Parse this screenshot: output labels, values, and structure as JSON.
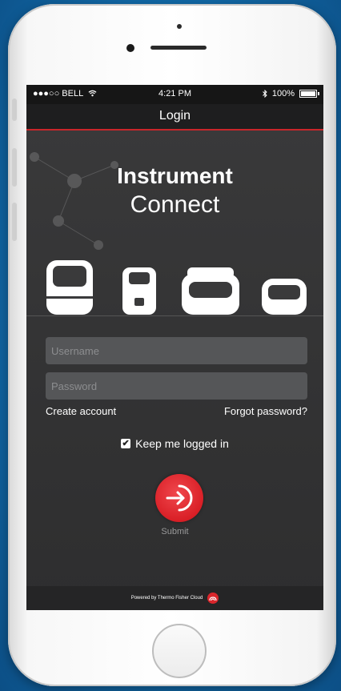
{
  "status_bar": {
    "carrier": "●●●○○ BELL",
    "time": "4:21 PM",
    "battery": "100%"
  },
  "nav": {
    "title": "Login"
  },
  "app": {
    "title_bold": "Instrument",
    "title_light": "Connect"
  },
  "form": {
    "username_placeholder": "Username",
    "password_placeholder": "Password",
    "create_account": "Create account",
    "forgot_password": "Forgot password?",
    "keep_logged_in": "Keep me logged in",
    "keep_logged_in_checked": true,
    "submit_label": "Submit"
  },
  "footer": {
    "powered_by": "Powered by Thermo Fisher Cloud"
  },
  "icons": {
    "wifi": "wifi-icon",
    "bluetooth": "bluetooth-icon",
    "battery": "battery-icon",
    "submit": "arrow-into-circle-icon",
    "footer_logo": "cloud-logo-icon"
  },
  "colors": {
    "accent": "#d91f26",
    "background": "#1168a6",
    "screen": "#343435",
    "field": "#555658"
  }
}
